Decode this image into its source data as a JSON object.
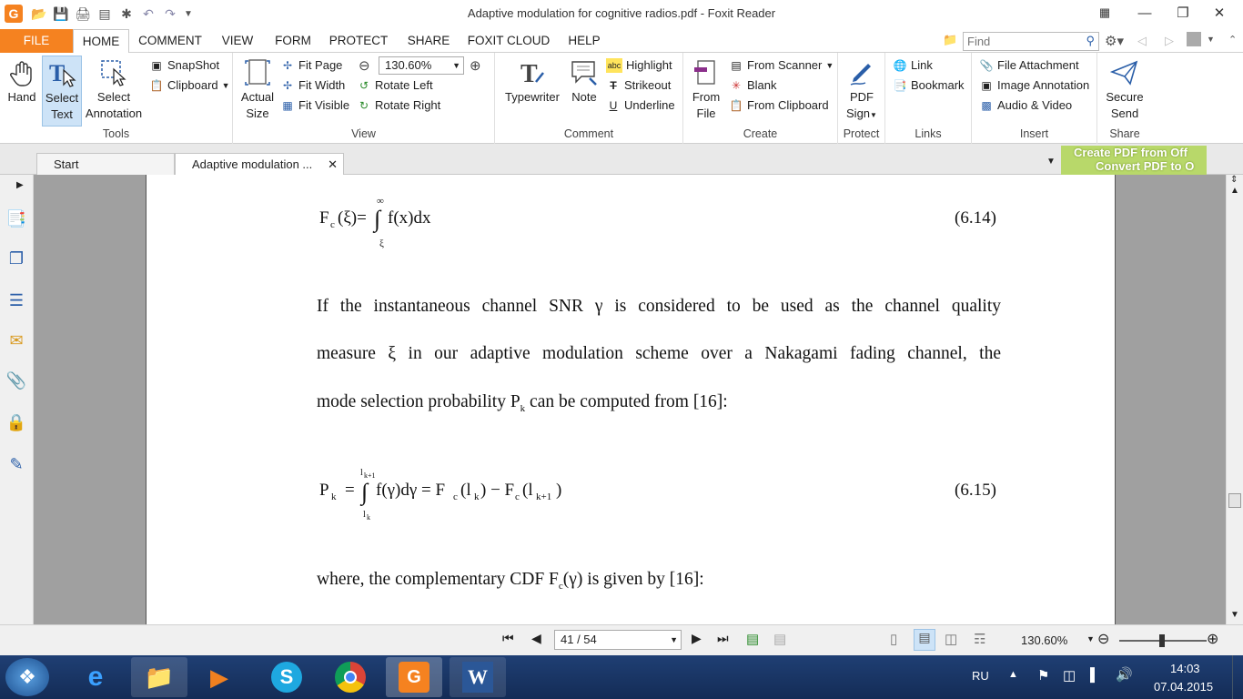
{
  "window": {
    "title": "Adaptive modulation for cognitive radios.pdf - Foxit Reader"
  },
  "menu_tabs": [
    "FILE",
    "HOME",
    "COMMENT",
    "VIEW",
    "FORM",
    "PROTECT",
    "SHARE",
    "FOXIT CLOUD",
    "HELP"
  ],
  "search": {
    "placeholder": "Find"
  },
  "ribbon": {
    "tools": {
      "label": "Tools",
      "hand": "Hand",
      "select_text_1": "Select",
      "select_text_2": "Text",
      "select_ann_1": "Select",
      "select_ann_2": "Annotation",
      "snapshot": "SnapShot",
      "clipboard": "Clipboard"
    },
    "view": {
      "label": "View",
      "actual_1": "Actual",
      "actual_2": "Size",
      "fit_page": "Fit Page",
      "fit_width": "Fit Width",
      "fit_visible": "Fit Visible",
      "zoom": "130.60%",
      "rotate_left": "Rotate Left",
      "rotate_right": "Rotate Right"
    },
    "comment": {
      "label": "Comment",
      "typewriter": "Typewriter",
      "note": "Note",
      "highlight": "Highlight",
      "strikeout": "Strikeout",
      "underline": "Underline"
    },
    "create": {
      "label": "Create",
      "from_file_1": "From",
      "from_file_2": "File",
      "from_scanner": "From Scanner",
      "blank": "Blank",
      "from_clipboard": "From Clipboard"
    },
    "protect": {
      "label": "Protect",
      "pdf_sign_1": "PDF",
      "pdf_sign_2": "Sign"
    },
    "links": {
      "label": "Links",
      "link": "Link",
      "bookmark": "Bookmark"
    },
    "insert": {
      "label": "Insert",
      "file_attachment": "File Attachment",
      "image_annotation": "Image Annotation",
      "audio_video": "Audio & Video"
    },
    "share": {
      "label": "Share",
      "secure_send_1": "Secure",
      "secure_send_2": "Send"
    }
  },
  "doc_tabs": [
    "Start",
    "Adaptive modulation ..."
  ],
  "ad_banner": {
    "line1": "Create PDF from Off",
    "line2": "Convert PDF to O"
  },
  "document": {
    "eq614_number": "(6.14)",
    "para1_line1": "If the instantaneous channel SNR γ is considered to be used as the channel quality",
    "para1_line2": "measure ξ in our adaptive modulation scheme over a Nakagami fading channel, the",
    "para1_line3": "mode selection probability P",
    "para1_line3_sub": "k",
    "para1_line3_end": " can be computed from [16]:",
    "eq615_number": "(6.15)",
    "para2": "where, the complementary CDF F",
    "para2_sub": "c",
    "para2_end": "(γ) is given by [16]:"
  },
  "status": {
    "page": "41 / 54",
    "zoom": "130.60%"
  },
  "taskbar": {
    "lang": "RU",
    "time": "14:03",
    "date": "07.04.2015"
  }
}
